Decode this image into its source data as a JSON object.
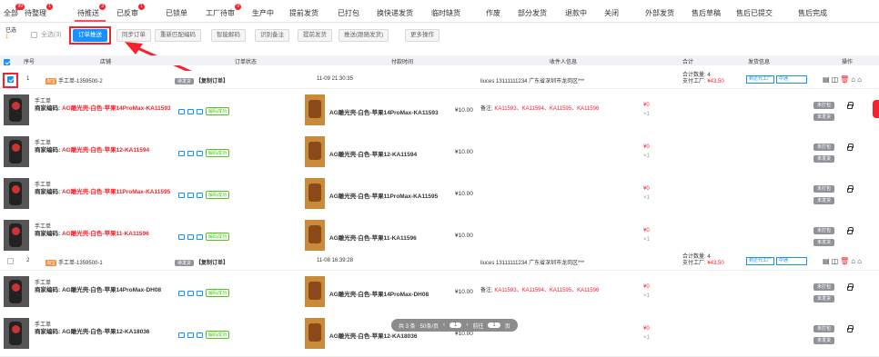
{
  "tabs": [
    {
      "label": "全部",
      "badge": "99"
    },
    {
      "label": "待整理",
      "badge": "1"
    },
    {
      "label": "待推送",
      "badge": "3"
    },
    {
      "label": "已反审",
      "badge": "1"
    },
    {
      "label": "已锁单",
      "badge": ""
    },
    {
      "label": "工厂待审",
      "badge": "9"
    },
    {
      "label": "生产中",
      "badge": ""
    },
    {
      "label": "提前发货",
      "badge": ""
    },
    {
      "label": "已打包",
      "badge": ""
    },
    {
      "label": "换快递发货",
      "badge": ""
    },
    {
      "label": "临时缺货",
      "badge": ""
    },
    {
      "label": "作废",
      "badge": ""
    },
    {
      "label": "部分发货",
      "badge": ""
    },
    {
      "label": "退款中",
      "badge": ""
    },
    {
      "label": "关闭",
      "badge": ""
    },
    {
      "label": "外部发货",
      "badge": ""
    },
    {
      "label": "售后草稿",
      "badge": ""
    },
    {
      "label": "售后已提交",
      "badge": ""
    },
    {
      "label": "售后完成",
      "badge": ""
    }
  ],
  "toolbar": {
    "selected_label": "已选",
    "selected_count": "1",
    "select_all": "全选(3)",
    "buttons": [
      "订单推送",
      "同步订单",
      "重新匹配编码",
      "智能解码",
      "识别备注",
      "提前发货",
      "推送(跟随发货)",
      "更多操作"
    ]
  },
  "table": {
    "headers": [
      "序号",
      "店铺",
      "订单状态",
      "付款时间",
      "收件人信息",
      "合计",
      "发货信息",
      "操作"
    ]
  },
  "orders": [
    {
      "no": "1",
      "platform": "淘宝",
      "shop": "手工单-1359500-2",
      "status": "待发货",
      "type": "【复制订单】",
      "pay_time": "11-09 21:30:35",
      "receiver": "liuces 13111111234 广东省深圳市龙岗区***",
      "total_qty": "合计数量: 4",
      "pay_factory": "支付工厂: ",
      "amount": "¥43.50",
      "ship_channel": "到达代工厂",
      "ship_method": "中通"
    },
    {
      "no": "2",
      "platform": "淘宝",
      "shop": "手工单-1359500-1",
      "status": "待发货",
      "type": "【复制订单】",
      "pay_time": "11-08 16:39:28",
      "receiver": "liuces 13111111234 广东省深圳市龙岗区***",
      "total_qty": "合计数量: 4",
      "pay_factory": "支付工厂: ",
      "amount": "¥43.50",
      "ship_channel": "到达代工厂",
      "ship_method": "中通"
    }
  ],
  "items": [
    {
      "type": "手工单",
      "code_label": "商家编码: ",
      "code": "AG雕光壳-白色-苹果14ProMax-KA11593",
      "code_red": true,
      "decode": "解码成功",
      "product": "AG雕光壳-白色-苹果14ProMax-KA11593",
      "price": "¥10.00",
      "remark_label": "备注: ",
      "remark": "KA11593、KA11594、KA11595、KA11596",
      "amount": "¥0",
      "qty": "×1",
      "pack": "未打包",
      "ship": "未发货"
    },
    {
      "type": "手工单",
      "code_label": "商家编码: ",
      "code": "AG雕光壳-白色-苹果12-KA11594",
      "code_red": true,
      "decode": "解码成功",
      "product": "AG雕光壳-白色-苹果12-KA11594",
      "price": "¥10.00",
      "remark_label": "",
      "remark": "",
      "amount": "¥0",
      "qty": "×1",
      "pack": "未打包",
      "ship": "未发货"
    },
    {
      "type": "手工单",
      "code_label": "商家编码: ",
      "code": "AG雕光壳-白色-苹果11ProMax-KA11595",
      "code_red": true,
      "decode": "解码成功",
      "product": "AG雕光壳-白色-苹果11ProMax-KA11595",
      "price": "¥10.00",
      "remark_label": "",
      "remark": "",
      "amount": "¥0",
      "qty": "×1",
      "pack": "未打包",
      "ship": "未发货"
    },
    {
      "type": "手工单",
      "code_label": "商家编码: ",
      "code": "AG雕光壳-白色-苹果11-KA11596",
      "code_red": true,
      "decode": "解码成功",
      "product": "AG雕光壳-白色-苹果11-KA11596",
      "price": "¥10.00",
      "remark_label": "",
      "remark": "",
      "amount": "¥0",
      "qty": "×1",
      "pack": "未打包",
      "ship": "未发货"
    },
    {
      "type": "手工单",
      "code_label": "商家编码: ",
      "code": "AG雕光壳-白色-苹果14ProMax-DH08",
      "code_red": false,
      "decode": "解码成功",
      "product": "AG雕光壳-白色-苹果14ProMax-DH08",
      "price": "¥10.00",
      "remark_label": "备注: ",
      "remark": "KA11593、KA11594、KA11595、KA11596",
      "amount": "¥0",
      "qty": "×1",
      "pack": "未打包",
      "ship": "未发货"
    },
    {
      "type": "手工单",
      "code_label": "商家编码: ",
      "code": "AG雕光壳-白色-苹果12-KA18036",
      "code_red": false,
      "decode": "解码成功",
      "product": "AG雕光壳-白色-苹果12-KA18036",
      "price": "¥10.00",
      "remark_label": "",
      "remark": "",
      "amount": "¥0",
      "qty": "×1",
      "pack": "未打包",
      "ship": "未发货"
    }
  ],
  "pager": {
    "total": "共 3 条",
    "page_size": "50条/页",
    "page": "1",
    "goto": "前往",
    "goto_page": "1",
    "page_unit": "页"
  },
  "colors": {
    "primary": "#1890ff",
    "danger": "#f5222d",
    "success": "#52c41a"
  }
}
